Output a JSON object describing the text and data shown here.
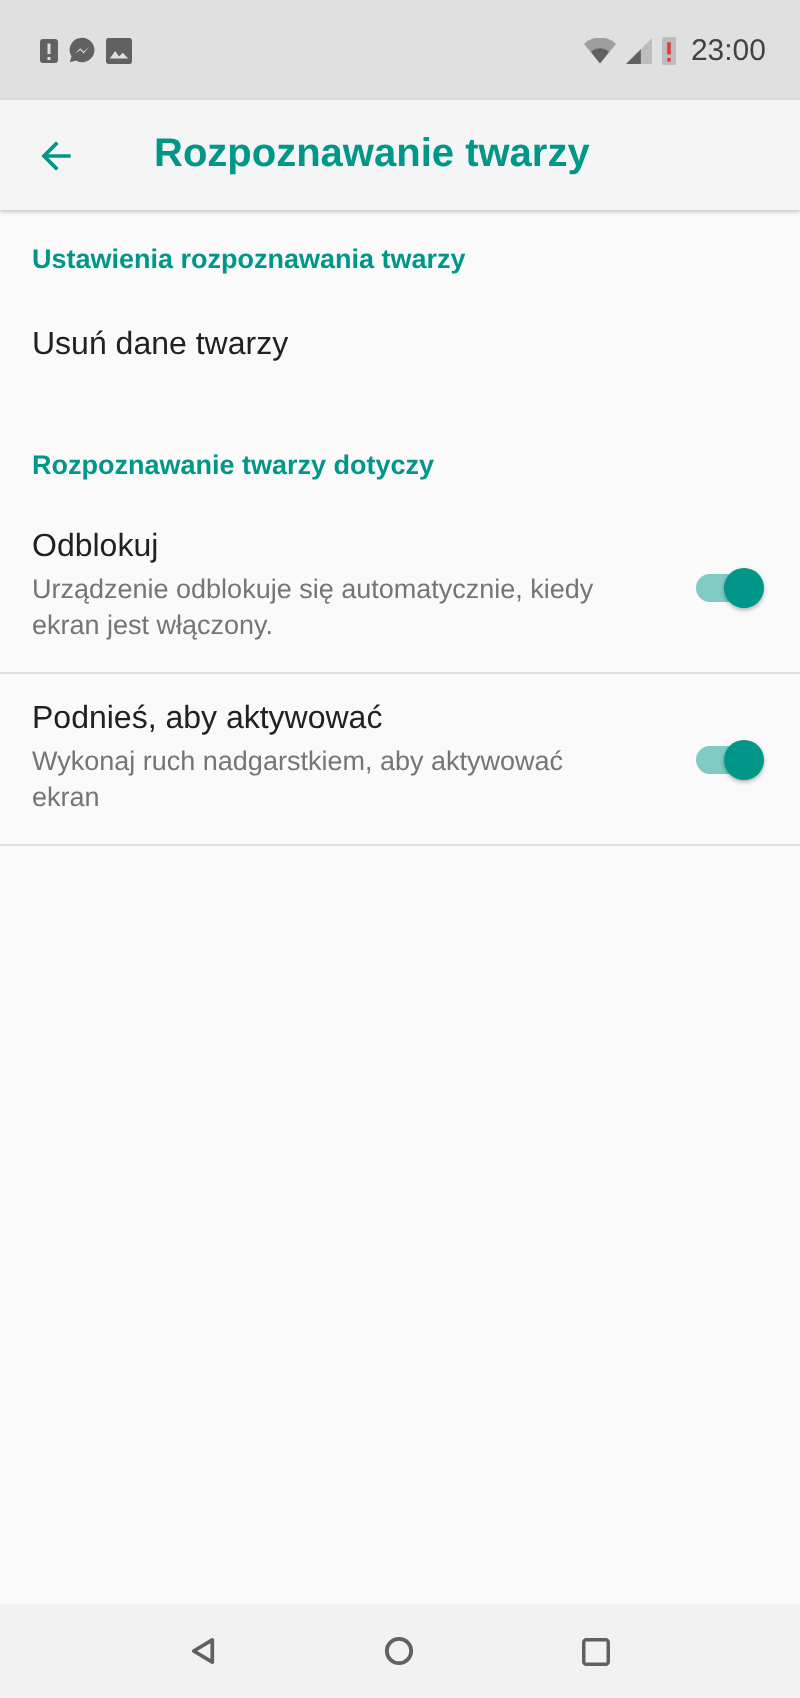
{
  "status_bar": {
    "time": "23:00"
  },
  "app_bar": {
    "title": "Rozpoznawanie twarzy"
  },
  "settings": [
    {
      "kind": "header",
      "title": "Ustawienia rozpoznawania twarzy"
    },
    {
      "kind": "item",
      "title": "Usuń dane twarzy"
    },
    {
      "kind": "header",
      "title": "Rozpoznawanie twarzy dotyczy"
    },
    {
      "kind": "switch",
      "title": "Odblokuj",
      "summary": "Urządzenie odblokuje się automatycznie, kiedy ekran jest włączony.",
      "on": true
    },
    {
      "kind": "switch",
      "title": "Podnieś, aby aktywować",
      "summary": "Wykonaj ruch nadgarstkiem, aby aktywować ekran",
      "on": true
    }
  ]
}
